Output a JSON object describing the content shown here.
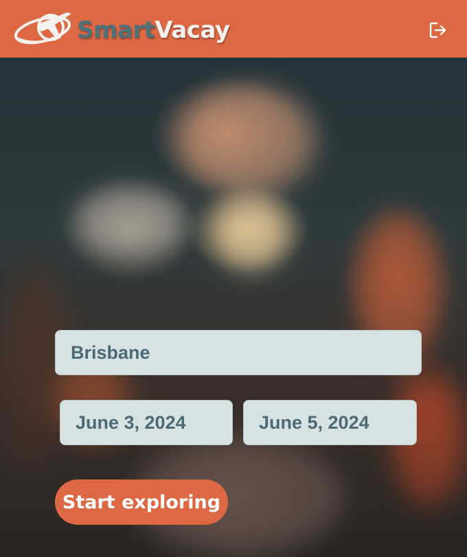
{
  "header": {
    "brand_part1": "Smart",
    "brand_part2": "Vacay",
    "logo_icon": "plane-globe-icon",
    "logout_icon": "logout-icon"
  },
  "form": {
    "destination_value": "Brisbane",
    "start_date_value": "June 3, 2024",
    "end_date_value": "June 5, 2024",
    "submit_label": "Start exploring"
  },
  "colors": {
    "header_bg": "#dd6844",
    "accent": "#dd6844",
    "field_bg": "#d7e2e3",
    "field_text": "#4b6a73",
    "brand_smart": "#4d7279",
    "brand_vacay": "#f5f1ec"
  }
}
